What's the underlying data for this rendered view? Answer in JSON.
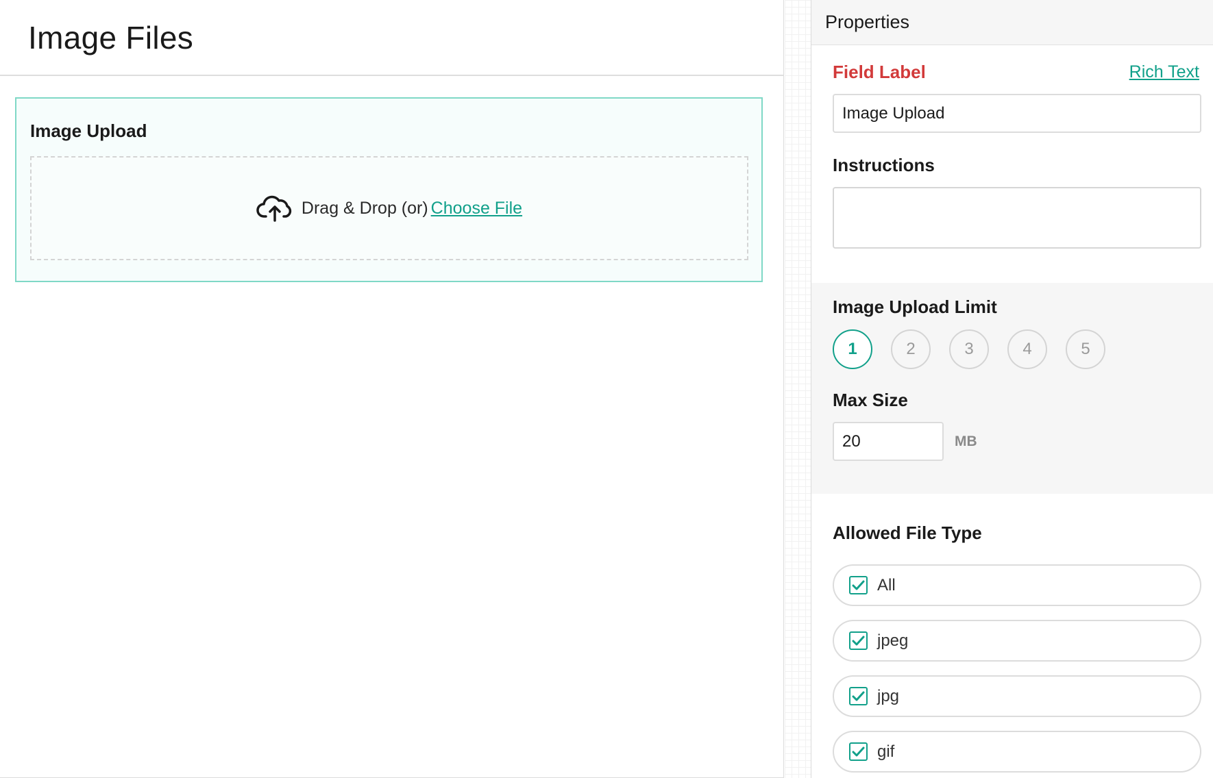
{
  "canvas": {
    "title": "Image Files",
    "field": {
      "label": "Image Upload",
      "dropzone": {
        "icon": "cloud-upload-icon",
        "text": "Drag & Drop (or)",
        "link": " Choose File"
      }
    }
  },
  "properties": {
    "header": "Properties",
    "field_label": {
      "title": "Field Label",
      "rich_text_link": "Rich Text",
      "value": "Image Upload"
    },
    "instructions": {
      "title": "Instructions",
      "value": ""
    },
    "upload_limit": {
      "title": "Image Upload Limit",
      "options": [
        "1",
        "2",
        "3",
        "4",
        "5"
      ],
      "selected": "1"
    },
    "max_size": {
      "title": "Max Size",
      "value": "20",
      "unit": "MB"
    },
    "allowed_file_type": {
      "title": "Allowed File Type",
      "items": [
        {
          "label": "All",
          "checked": true
        },
        {
          "label": "jpeg",
          "checked": true
        },
        {
          "label": "jpg",
          "checked": true
        },
        {
          "label": "gif",
          "checked": true
        }
      ]
    }
  },
  "colors": {
    "accent": "#11a08a",
    "required_label": "#d23a3a",
    "card_border": "#7fd8c6",
    "card_background": "#f6fdfc",
    "panel_band": "#f6f6f6"
  }
}
